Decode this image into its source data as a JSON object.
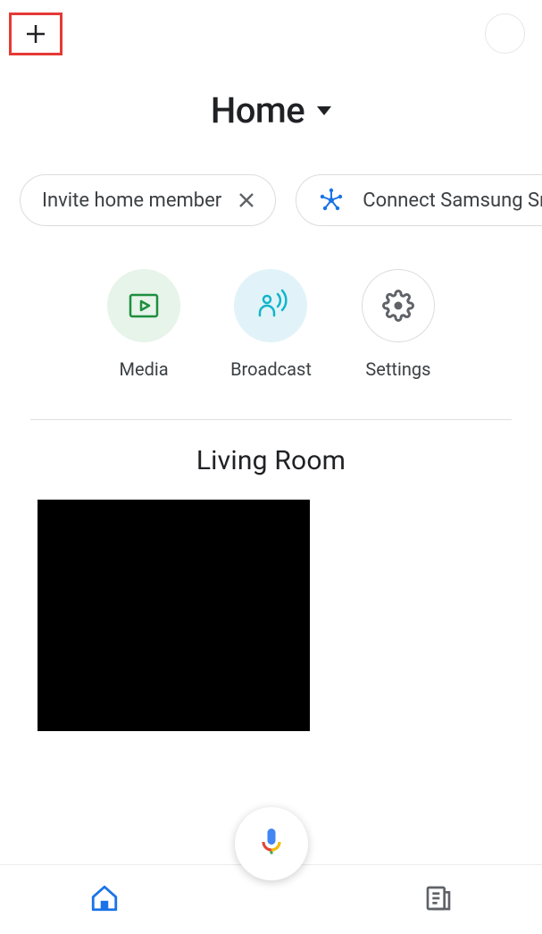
{
  "header": {
    "home_label": "Home"
  },
  "chips": [
    {
      "label": "Invite home member",
      "dismissable": true
    },
    {
      "label": "Connect Samsung Sma",
      "leading_icon": "smartthings"
    }
  ],
  "actions": {
    "media": {
      "label": "Media"
    },
    "broadcast": {
      "label": "Broadcast"
    },
    "settings": {
      "label": "Settings"
    }
  },
  "rooms": [
    {
      "name": "Living Room"
    }
  ]
}
